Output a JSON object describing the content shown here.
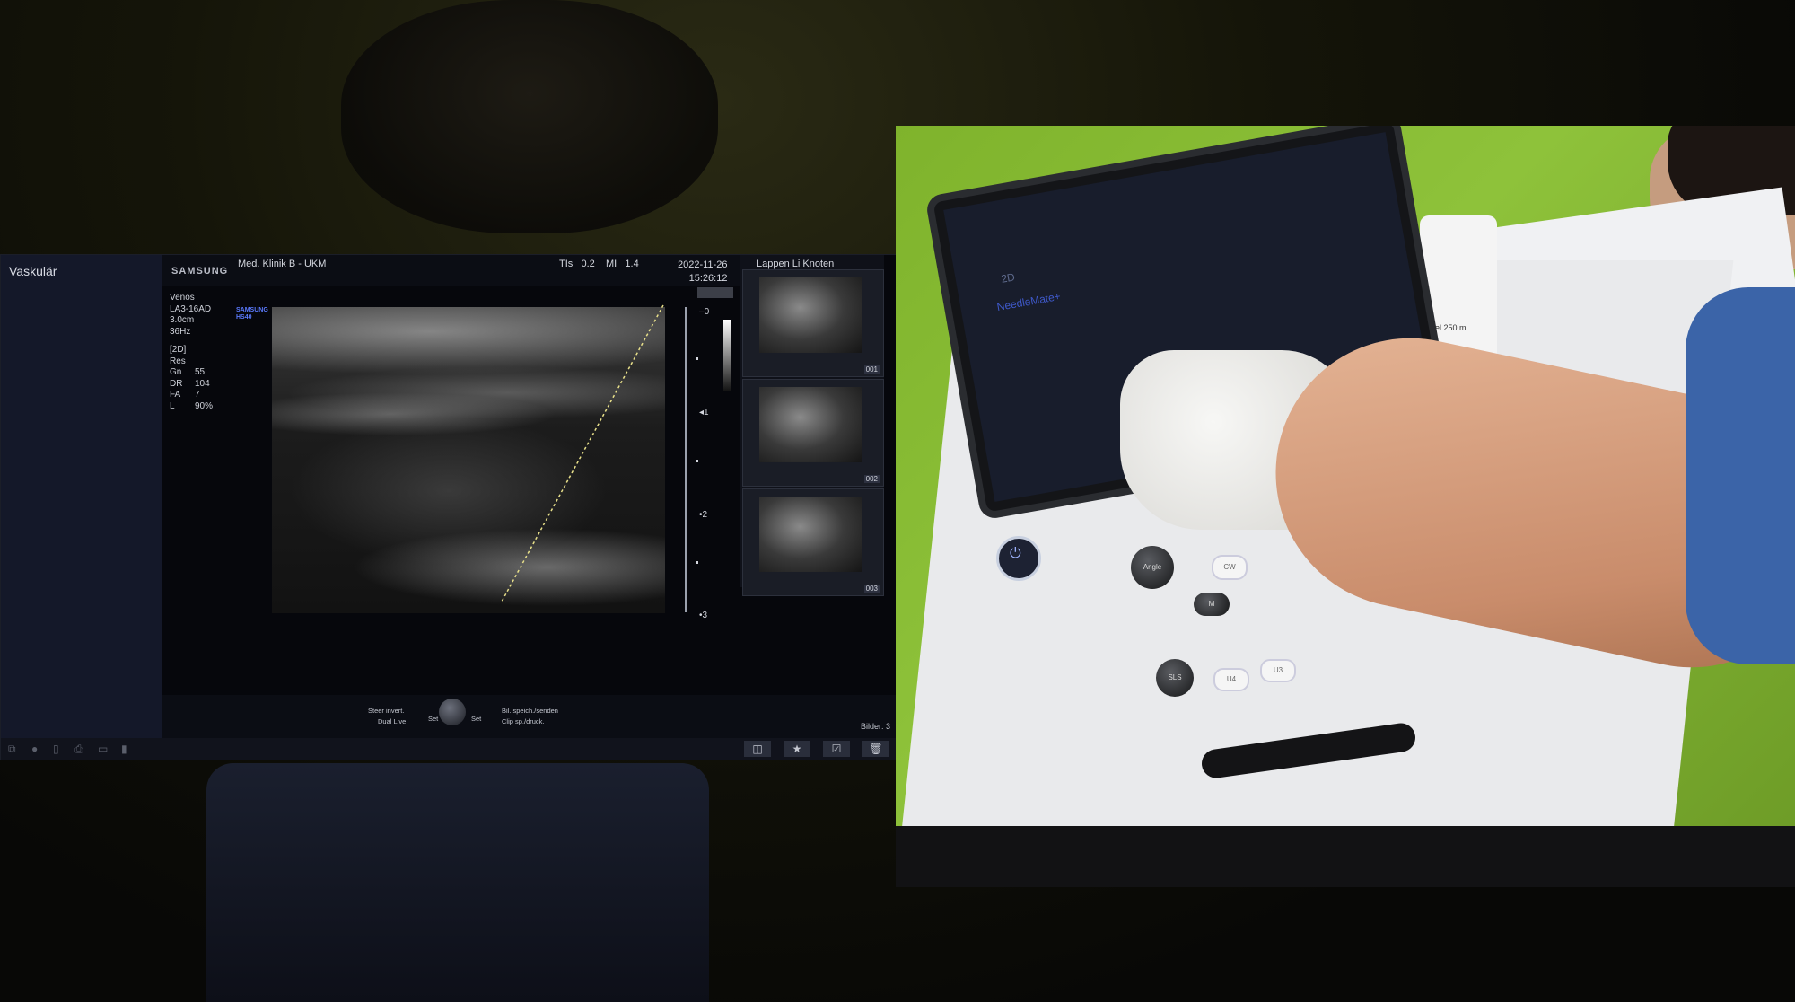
{
  "ultrasound": {
    "sidebar_mode": "Vaskulär",
    "brand": "SAMSUNG",
    "facility": "Med. Klinik B - UKM",
    "tis_label": "TIs",
    "tis_value": "0.2",
    "mi_label": "MI",
    "mi_value": "1.4",
    "date": "2022-11-26",
    "time": "15:26:12",
    "params": [
      "Venös",
      "LA3-16AD",
      "3.0cm",
      "36Hz"
    ],
    "sub_logo": [
      "SAMSUNG",
      "HS40"
    ],
    "mode_block": "[2D]",
    "res": "Res",
    "gain": [
      {
        "k": "Gn",
        "v": "55"
      },
      {
        "k": "DR",
        "v": "104"
      },
      {
        "k": "FA",
        "v": "7"
      },
      {
        "k": "L",
        "v": "90%"
      }
    ],
    "depth_scale": [
      "0",
      "1",
      "2",
      "3"
    ],
    "thumbnails_title": "Lappen Li Knoten",
    "thumbnails": [
      {
        "num": "001"
      },
      {
        "num": "002"
      },
      {
        "num": "003"
      }
    ],
    "controls": {
      "steer_invert": "Steer invert.",
      "dual_live": "Dual Live",
      "set_left": "Set",
      "set_right": "Set",
      "bild_speich": "Bil. speich./senden",
      "clip_sp": "Clip sp./druck."
    },
    "bilder": "Bilder: 3"
  },
  "photo": {
    "tablet_2d": "2D",
    "tablet_needlemate": "NeedleMate+",
    "bottle_text": "gel 250 ml",
    "knobs": [
      "Angle",
      "CW",
      "M",
      "SLS",
      "U4",
      "U3"
    ]
  }
}
